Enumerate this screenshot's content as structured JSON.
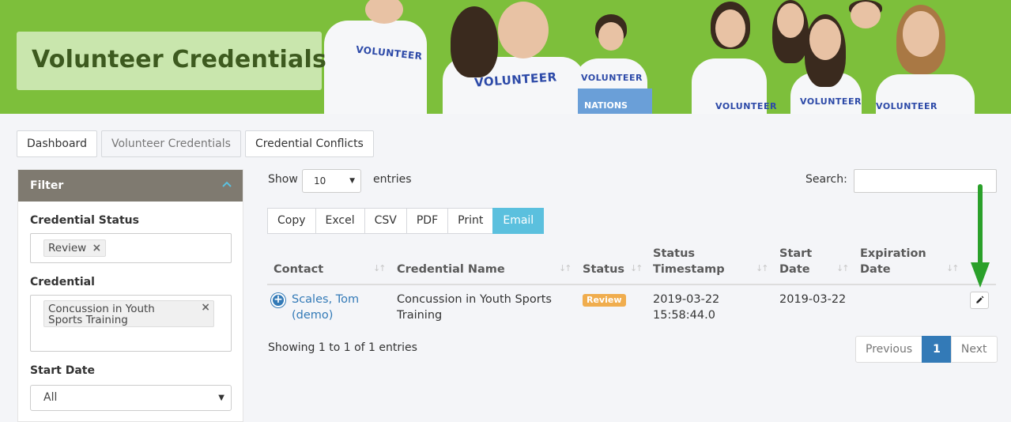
{
  "banner": {
    "title": "Volunteer Credentials",
    "shirt_text": "VOLUNTEER",
    "box_text": "NATIONS",
    "brand_green": "#7dbf3b"
  },
  "tabs": [
    {
      "label": "Dashboard",
      "active": false
    },
    {
      "label": "Volunteer Credentials",
      "active": true
    },
    {
      "label": "Credential Conflicts",
      "active": false
    }
  ],
  "filter": {
    "title": "Filter",
    "collapse_icon": "chevron-up-icon",
    "credential_status": {
      "label": "Credential Status",
      "chips": [
        "Review"
      ]
    },
    "credential": {
      "label": "Credential",
      "chips": [
        "Concussion in Youth Sports Training"
      ],
      "chip_line1": "Concussion in Youth",
      "chip_line2": "Sports Training"
    },
    "start_date": {
      "label": "Start Date",
      "selected": "All"
    }
  },
  "table_controls": {
    "show_label": "Show",
    "page_size": "10",
    "entries_label": "entries",
    "search_label": "Search:",
    "search_value": ""
  },
  "export_buttons": [
    "Copy",
    "Excel",
    "CSV",
    "PDF",
    "Print",
    "Email"
  ],
  "table": {
    "columns": [
      {
        "label": "Contact"
      },
      {
        "label": "Credential Name"
      },
      {
        "label": "Status"
      },
      {
        "label_line1": "Status",
        "label_line2": "Timestamp"
      },
      {
        "label_line1": "Start",
        "label_line2": "Date"
      },
      {
        "label_line1": "Expiration",
        "label_line2": "Date"
      }
    ],
    "rows": [
      {
        "contact_line1": "Scales, Tom",
        "contact_line2": "(demo)",
        "credential_line1": "Concussion in Youth Sports",
        "credential_line2": "Training",
        "status": "Review",
        "timestamp_date": "2019-03-22",
        "timestamp_time": "15:58:44.0",
        "start_date": "2019-03-22",
        "expiration_date": "",
        "edit_icon": "pencil-icon"
      }
    ]
  },
  "info_text": "Showing 1 to 1 of 1 entries",
  "pagination": {
    "previous": "Previous",
    "current": "1",
    "next": "Next"
  },
  "colors": {
    "filter_header": "#7f7a70",
    "email_button": "#5bc0de",
    "link": "#337ab7",
    "review_badge": "#f0ad4e",
    "annotation_arrow": "#2aa02a"
  }
}
